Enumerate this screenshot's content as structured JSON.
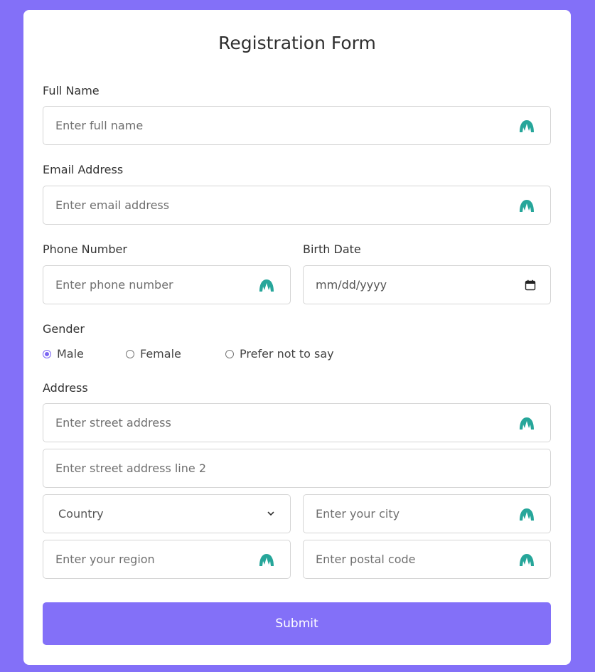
{
  "form": {
    "title": "Registration Form",
    "accent_color": "#8370f8",
    "field_icon_color": "#26a69a",
    "full_name": {
      "label": "Full Name",
      "placeholder": "Enter full name",
      "icon": "spike-icon"
    },
    "email": {
      "label": "Email Address",
      "placeholder": "Enter email address",
      "icon": "spike-icon"
    },
    "phone": {
      "label": "Phone Number",
      "placeholder": "Enter phone number",
      "icon": "spike-icon"
    },
    "birth_date": {
      "label": "Birth Date",
      "placeholder": "mm/dd/yyyy",
      "icon": "calendar-icon"
    },
    "gender": {
      "label": "Gender",
      "options": [
        {
          "label": "Male",
          "selected": true
        },
        {
          "label": "Female",
          "selected": false
        },
        {
          "label": "Prefer not to say",
          "selected": false
        }
      ]
    },
    "address": {
      "label": "Address",
      "street": {
        "placeholder": "Enter street address",
        "icon": "spike-icon"
      },
      "street2": {
        "placeholder": "Enter street address line 2"
      },
      "country": {
        "value": "Country",
        "icon": "chevron-down-icon"
      },
      "city": {
        "placeholder": "Enter your city",
        "icon": "spike-icon"
      },
      "region": {
        "placeholder": "Enter your region",
        "icon": "spike-icon"
      },
      "postal": {
        "placeholder": "Enter postal code",
        "icon": "spike-icon"
      }
    },
    "submit_label": "Submit"
  }
}
